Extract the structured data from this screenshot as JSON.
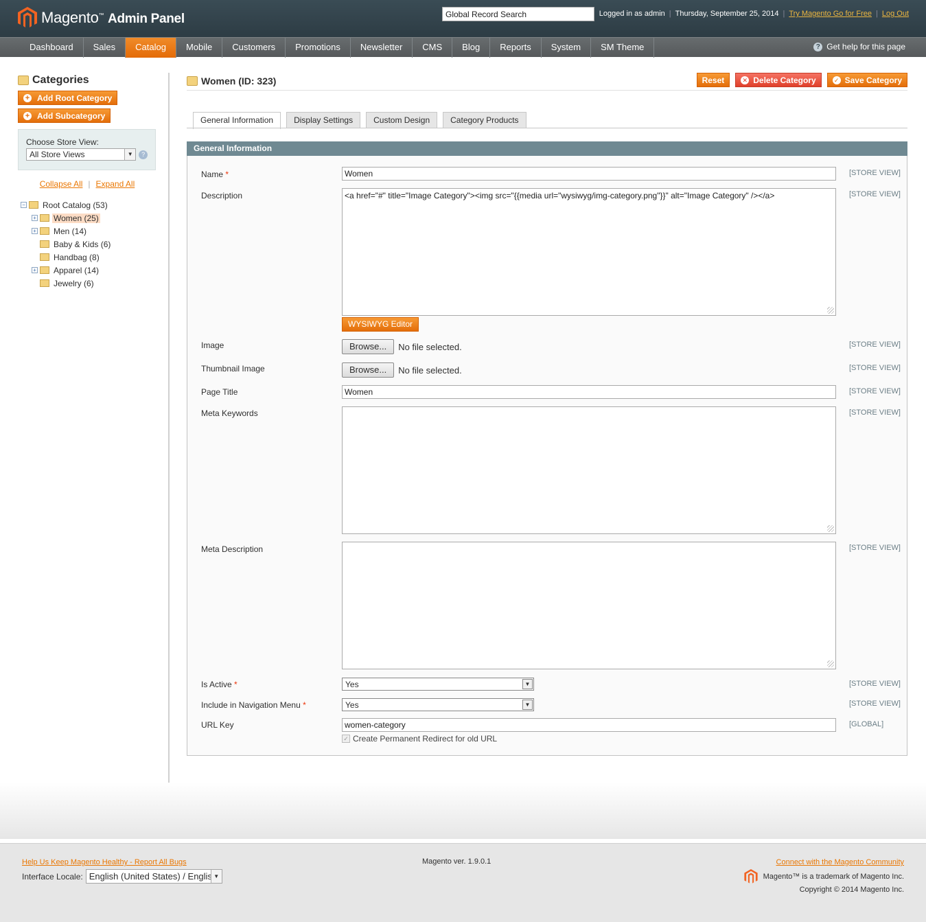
{
  "header": {
    "logo_text": "Magento",
    "logo_sub": "Admin Panel",
    "search_value": "Global Record Search",
    "logged_in": "Logged in as admin",
    "date": "Thursday, September 25, 2014",
    "try_link": "Try Magento Go for Free",
    "logout": "Log Out"
  },
  "nav": {
    "items": [
      "Dashboard",
      "Sales",
      "Catalog",
      "Mobile",
      "Customers",
      "Promotions",
      "Newsletter",
      "CMS",
      "Blog",
      "Reports",
      "System",
      "SM Theme"
    ],
    "active": "Catalog",
    "help": "Get help for this page"
  },
  "sidebar": {
    "title": "Categories",
    "add_root": "Add Root Category",
    "add_sub": "Add Subcategory",
    "store_view_label": "Choose Store View:",
    "store_view_value": "All Store Views",
    "collapse_all": "Collapse All",
    "expand_all": "Expand All",
    "tree": {
      "root": "Root Catalog (53)",
      "children": [
        {
          "label": "Women (25)",
          "expandable": true,
          "selected": true
        },
        {
          "label": "Men (14)",
          "expandable": true,
          "selected": false
        },
        {
          "label": "Baby & Kids (6)",
          "expandable": false,
          "selected": false
        },
        {
          "label": "Handbag (8)",
          "expandable": false,
          "selected": false
        },
        {
          "label": "Apparel (14)",
          "expandable": true,
          "selected": false
        },
        {
          "label": "Jewelry (6)",
          "expandable": false,
          "selected": false
        }
      ]
    }
  },
  "main": {
    "title": "Women (ID: 323)",
    "reset": "Reset",
    "delete": "Delete Category",
    "save": "Save Category",
    "tabs": [
      "General Information",
      "Display Settings",
      "Custom Design",
      "Category Products"
    ],
    "section_title": "General Information",
    "fields": {
      "name_label": "Name",
      "name_value": "Women",
      "description_label": "Description",
      "description_value": "<a href=\"#\" title=\"Image Category\"><img src=\"{{media url=\"wysiwyg/img-category.png\"}}\" alt=\"Image Category\" /></a>",
      "wysiwyg": "WYSIWYG Editor",
      "image_label": "Image",
      "thumbnail_label": "Thumbnail Image",
      "browse": "Browse...",
      "no_file": "No file selected.",
      "page_title_label": "Page Title",
      "page_title_value": "Women",
      "meta_keywords_label": "Meta Keywords",
      "meta_description_label": "Meta Description",
      "is_active_label": "Is Active",
      "is_active_value": "Yes",
      "include_nav_label": "Include in Navigation Menu",
      "include_nav_value": "Yes",
      "url_key_label": "URL Key",
      "url_key_value": "women-category",
      "redirect_label": "Create Permanent Redirect for old URL"
    },
    "scope_store": "[STORE VIEW]",
    "scope_global": "[GLOBAL]"
  },
  "footer": {
    "report_bugs": "Help Us Keep Magento Healthy - Report All Bugs",
    "locale_label": "Interface Locale:",
    "locale_value": "English (United States) / English",
    "version": "Magento ver. 1.9.0.1",
    "community": "Connect with the Magento Community",
    "trademark": "Magento™ is a trademark of Magento Inc.",
    "copyright": "Copyright © 2014 Magento Inc."
  },
  "colors": {
    "accent_orange": "#e46e0a",
    "header_bg": "#2d3c44",
    "section_head": "#6f8992",
    "delete_red": "#e0402b"
  }
}
